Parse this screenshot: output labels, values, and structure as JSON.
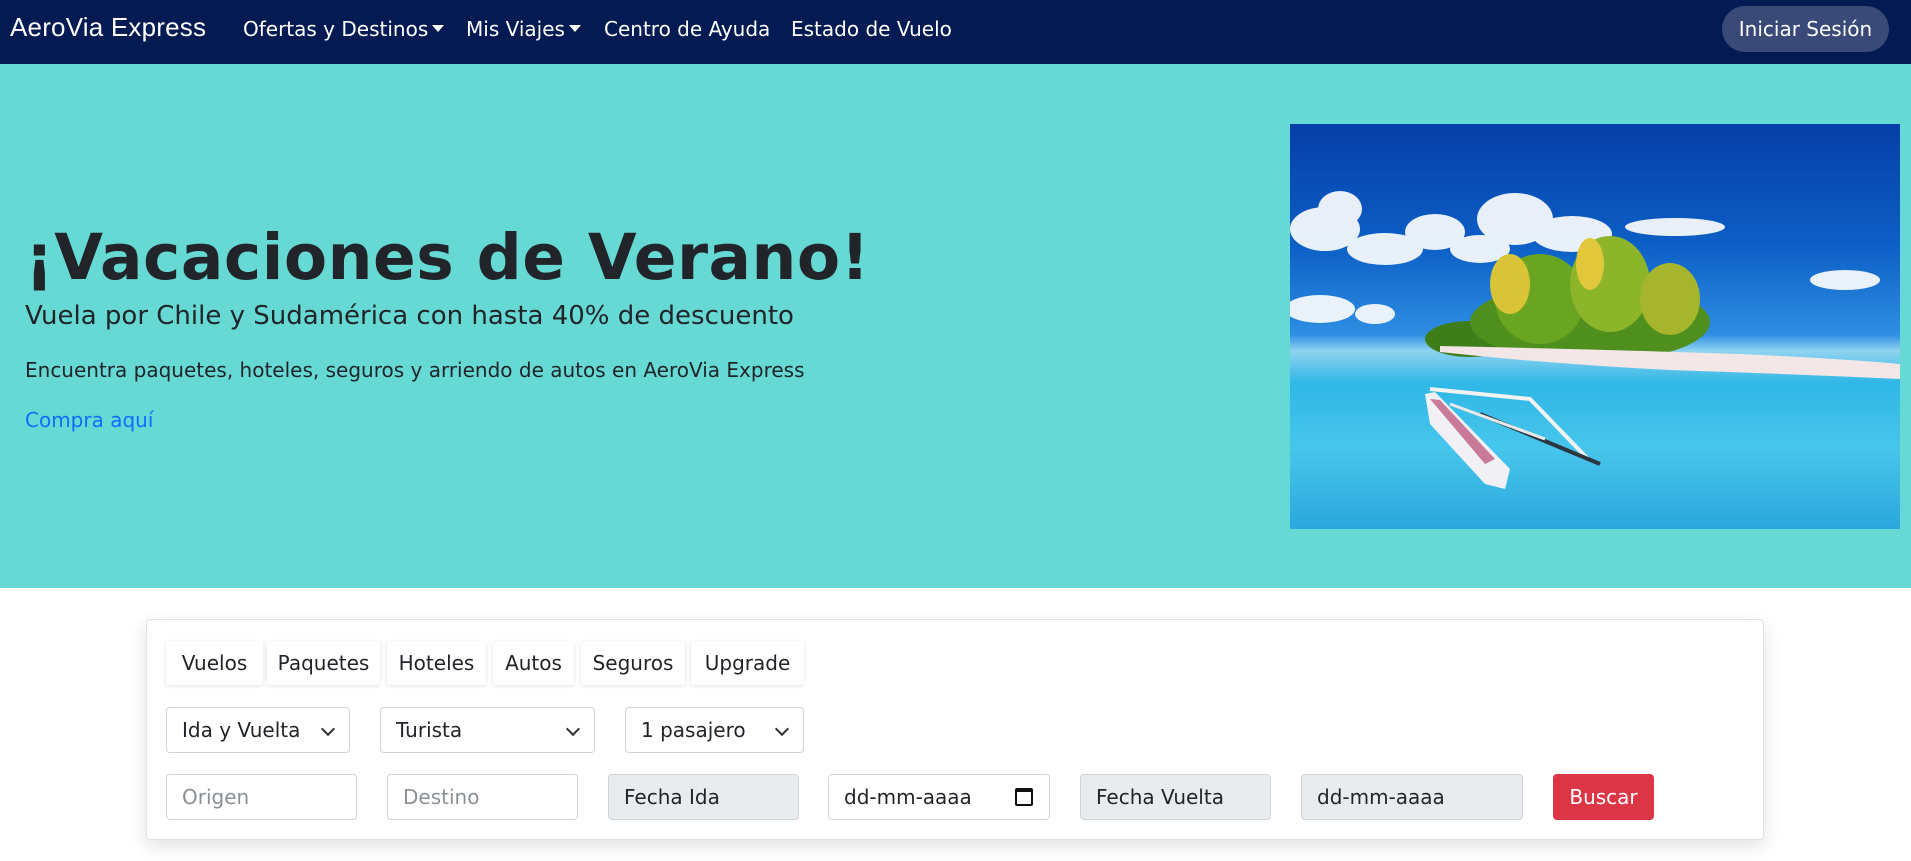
{
  "navbar": {
    "brand": "AeroVia Express",
    "links": [
      {
        "label": "Ofertas y Destinos",
        "dropdown": true
      },
      {
        "label": "Mis Viajes",
        "dropdown": true
      },
      {
        "label": "Centro de Ayuda",
        "dropdown": false
      },
      {
        "label": "Estado de Vuelo",
        "dropdown": false
      }
    ],
    "login_label": "Iniciar Sesión"
  },
  "hero": {
    "title": "¡Vacaciones de Verano!",
    "subtitle": "Vuela por Chile y Sudamérica con hasta 40% de descuento",
    "description": "Encuentra paquetes, hoteles, seguros y arriendo de autos en AeroVia Express",
    "link_label": "Compra aquí"
  },
  "search": {
    "tabs": [
      "Vuelos",
      "Paquetes",
      "Hoteles",
      "Autos",
      "Seguros",
      "Upgrade"
    ],
    "trip_type": "Ida y Vuelta",
    "cabin_class": "Turista",
    "passengers": "1 pasajero",
    "origin_placeholder": "Origen",
    "destination_placeholder": "Destino",
    "departure_label": "Fecha Ida",
    "departure_date_placeholder": "dd-mm-aaaa",
    "return_label": "Fecha Vuelta",
    "return_date_placeholder": "dd-mm-aaaa",
    "submit_label": "Buscar"
  },
  "colors": {
    "navbar": "#031a52",
    "hero_bg": "#66d9d4",
    "link": "#0d6efd",
    "search_button": "#dc3545"
  }
}
